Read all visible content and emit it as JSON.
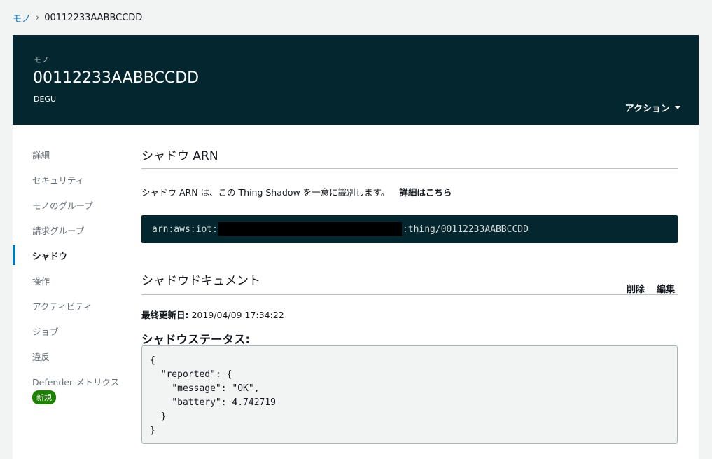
{
  "breadcrumb": {
    "parent": "モノ",
    "separator": "›",
    "current": "00112233AABBCCDD"
  },
  "header": {
    "kind": "モノ",
    "title": "00112233AABBCCDD",
    "subtitle": "DEGU",
    "actions_label": "アクション"
  },
  "nav": {
    "items": [
      {
        "label": "詳細"
      },
      {
        "label": "セキュリティ"
      },
      {
        "label": "モノのグループ"
      },
      {
        "label": "請求グループ"
      },
      {
        "label": "シャドウ"
      },
      {
        "label": "操作"
      },
      {
        "label": "アクティビティ"
      },
      {
        "label": "ジョブ"
      },
      {
        "label": "違反"
      },
      {
        "label": "Defender メトリクス"
      }
    ],
    "active_index": 4,
    "new_badge": "新規"
  },
  "arn_section": {
    "title": "シャドウ ARN",
    "description": "シャドウ ARN は、この Thing Shadow を一意に識別します。",
    "learn_more": "詳細はこちら",
    "arn_prefix": "arn:aws:iot:",
    "arn_suffix": ":thing/00112233AABBCCDD"
  },
  "document_section": {
    "title": "シャドウドキュメント",
    "delete_label": "削除",
    "edit_label": "編集",
    "updated_label": "最終更新日:",
    "updated_value": "2019/04/09 17:34:22",
    "status_label": "シャドウステータス:",
    "json_text": "{\n  \"reported\": {\n    \"message\": \"OK\",\n    \"battery\": 4.742719\n  }\n}"
  },
  "colors": {
    "header_bg": "#04272f",
    "link": "#0073bb",
    "active_bar": "#0073bb",
    "badge_bg": "#1d8102"
  }
}
